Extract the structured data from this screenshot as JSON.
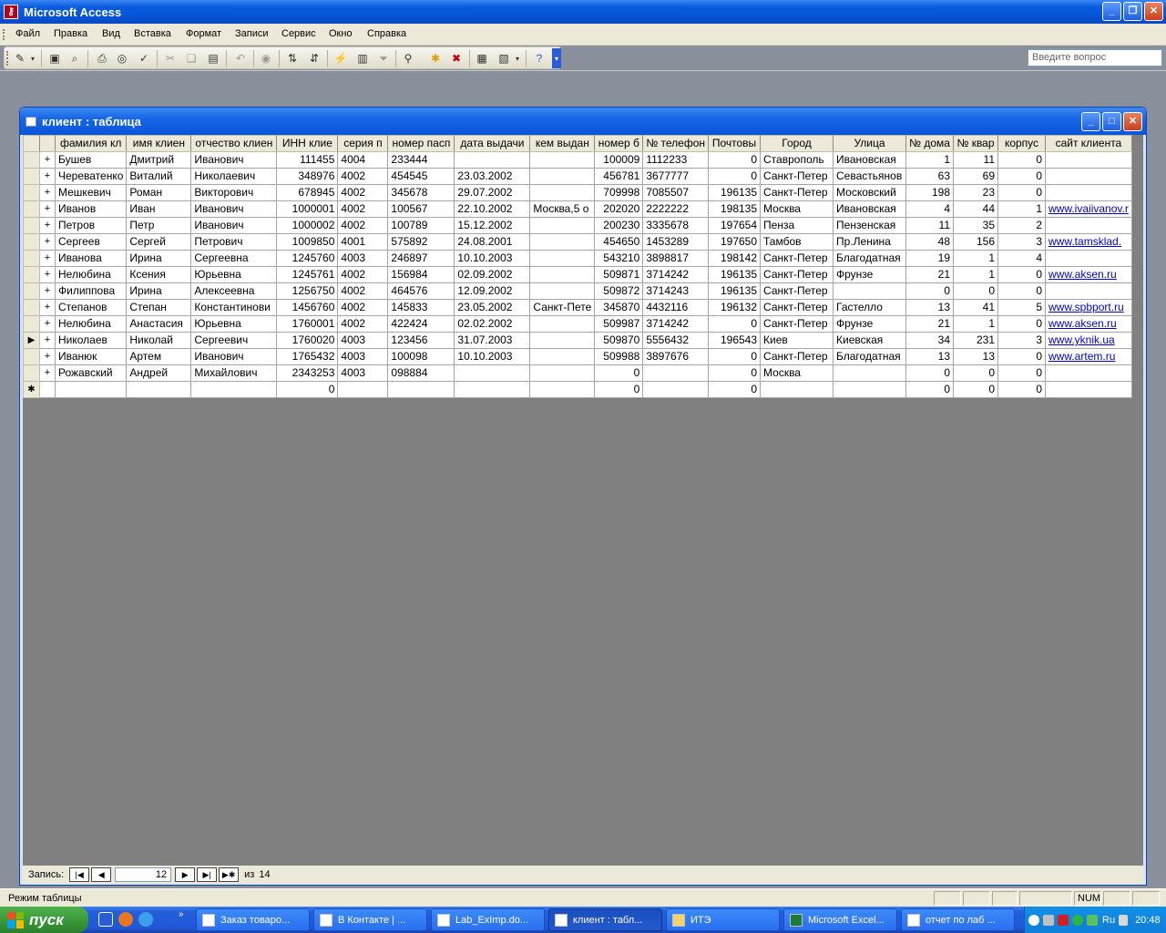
{
  "app": {
    "title": "Microsoft Access"
  },
  "menu": [
    "Файл",
    "Правка",
    "Вид",
    "Вставка",
    "Формат",
    "Записи",
    "Сервис",
    "Окно",
    "Справка"
  ],
  "ask": {
    "placeholder": "Введите вопрос"
  },
  "toolbar_icons": [
    "view-icon",
    "save-icon",
    "search-file-icon",
    "print-icon",
    "print-preview-icon",
    "spelling-icon",
    "cut-icon",
    "copy-icon",
    "paste-icon",
    "undo-icon",
    "hyperlink-icon",
    "sort-asc-icon",
    "sort-desc-icon",
    "filter-selection-icon",
    "filter-form-icon",
    "apply-filter-icon",
    "find-icon",
    "new-record-icon",
    "delete-record-icon",
    "database-window-icon",
    "new-object-icon",
    "help-icon"
  ],
  "doc": {
    "title": "клиент : таблица"
  },
  "table": {
    "columns": [
      "фамилия кл",
      "имя клиен",
      "отчество клиен",
      "ИНН клие",
      "серия п",
      "номер пасп",
      "дата выдачи",
      "кем выдан",
      "номер б",
      "№ телефон",
      "Почтовы",
      "Город",
      "Улица",
      "№ дома",
      "№ квар",
      "корпус",
      "сайт клиента"
    ],
    "rows": [
      [
        "Бушев",
        "Дмитрий",
        "Иванович",
        "111455",
        "4004",
        "233444",
        "",
        "",
        "100009",
        "1112233",
        "0",
        "Ставрополь",
        "Ивановская",
        "1",
        "11",
        "0",
        ""
      ],
      [
        "Череватенко",
        "Виталий",
        "Николаевич",
        "348976",
        "4002",
        "454545",
        "23.03.2002",
        "",
        "456781",
        "3677777",
        "0",
        "Санкт-Петер",
        "Севастьянов",
        "63",
        "69",
        "0",
        ""
      ],
      [
        "Мешкевич",
        "Роман",
        "Викторович",
        "678945",
        "4002",
        "345678",
        "29.07.2002",
        "",
        "709998",
        "7085507",
        "196135",
        "Санкт-Петер",
        "Московский",
        "198",
        "23",
        "0",
        ""
      ],
      [
        "Иванов",
        "Иван",
        "Иванович",
        "1000001",
        "4002",
        "100567",
        "22.10.2002",
        "Москва,5 о",
        "202020",
        "2222222",
        "198135",
        "Москва",
        "Ивановская",
        "4",
        "44",
        "1",
        "www.ivaiivanov.r"
      ],
      [
        "Петров",
        "Петр",
        "Иванович",
        "1000002",
        "4002",
        "100789",
        "15.12.2002",
        "",
        "200230",
        "3335678",
        "197654",
        "Пенза",
        "Пензенская",
        "11",
        "35",
        "2",
        ""
      ],
      [
        "Сергеев",
        "Сергей",
        "Петрович",
        "1009850",
        "4001",
        "575892",
        "24.08.2001",
        "",
        "454650",
        "1453289",
        "197650",
        "Тамбов",
        "Пр.Ленина",
        "48",
        "156",
        "3",
        "www.tamsklad."
      ],
      [
        "Иванова",
        "Ирина",
        "Сергеевна",
        "1245760",
        "4003",
        "246897",
        "10.10.2003",
        "",
        "543210",
        "3898817",
        "198142",
        "Санкт-Петер",
        "Благодатная",
        "19",
        "1",
        "4",
        ""
      ],
      [
        "Нелюбина",
        "Ксения",
        "Юрьевна",
        "1245761",
        "4002",
        "156984",
        "02.09.2002",
        "",
        "509871",
        "3714242",
        "196135",
        "Санкт-Петер",
        "Фрунзе",
        "21",
        "1",
        "0",
        "www.aksen.ru"
      ],
      [
        "Филиппова",
        "Ирина",
        "Алексеевна",
        "1256750",
        "4002",
        "464576",
        "12.09.2002",
        "",
        "509872",
        "3714243",
        "196135",
        "Санкт-Петер",
        "",
        "0",
        "0",
        "0",
        ""
      ],
      [
        "Степанов",
        "Степан",
        "Константинови",
        "1456760",
        "4002",
        "145833",
        "23.05.2002",
        "Санкт-Пете",
        "345870",
        "4432116",
        "196132",
        "Санкт-Петер",
        "Гастелло",
        "13",
        "41",
        "5",
        "www.spbport.ru"
      ],
      [
        "Нелюбина",
        "Анастасия",
        "Юрьевна",
        "1760001",
        "4002",
        "422424",
        "02.02.2002",
        "",
        "509987",
        "3714242",
        "0",
        "Санкт-Петер",
        "Фрунзе",
        "21",
        "1",
        "0",
        "www.aksen.ru"
      ],
      [
        "Николаев",
        "Николай",
        "Сергеевич",
        "1760020",
        "4003",
        "123456",
        "31.07.2003",
        "",
        "509870",
        "5556432",
        "196543",
        "Киев",
        "Киевская",
        "34",
        "231",
        "3",
        "www.yknik.ua"
      ],
      [
        "Иванюк",
        "Артем",
        "Иванович",
        "1765432",
        "4003",
        "100098",
        "10.10.2003",
        "",
        "509988",
        "3897676",
        "0",
        "Санкт-Петер",
        "Благодатная",
        "13",
        "13",
        "0",
        "www.artem.ru"
      ],
      [
        "Рожавский",
        "Андрей",
        "Михайлович",
        "2343253",
        "4003",
        "098884",
        "",
        "",
        "0",
        "",
        "0",
        "Москва",
        "",
        "0",
        "0",
        "0",
        ""
      ]
    ],
    "new_row": [
      "",
      "",
      "",
      "0",
      "",
      "",
      "",
      "",
      "0",
      "",
      "0",
      "",
      "",
      "0",
      "0",
      "0",
      ""
    ],
    "current_row": 11
  },
  "nav": {
    "label": "Запись:",
    "current": "12",
    "of_label": "из",
    "total": "14"
  },
  "status": {
    "text": "Режим таблицы",
    "num": "NUM"
  },
  "taskbar": {
    "start": "пуск",
    "tasks": [
      "Заказ товаро...",
      "В Контакте | ...",
      "Lab_ExImp.do...",
      "клиент : табл...",
      "ИТЭ",
      "Microsoft Excel...",
      "отчет по лаб ..."
    ],
    "active_task": 3,
    "lang": "Ru",
    "clock": "20:48"
  }
}
